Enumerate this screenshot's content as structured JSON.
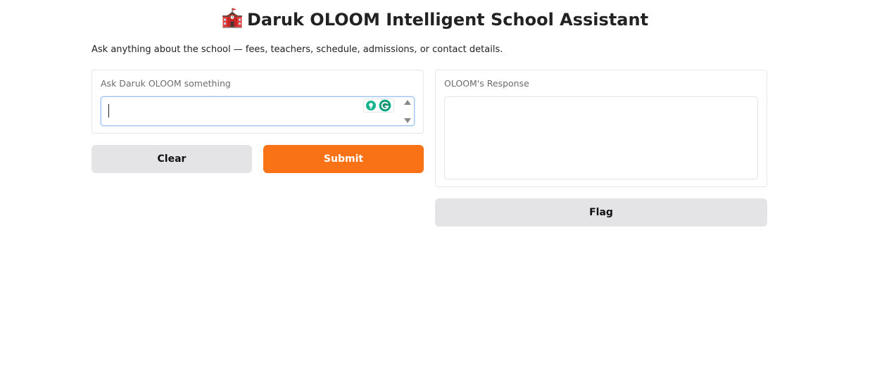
{
  "header": {
    "icon": "school-building-icon",
    "title": "Daruk OLOOM Intelligent School Assistant"
  },
  "description": "Ask anything about the school — fees, teachers, schedule, admissions, or contact details.",
  "input_panel": {
    "label": "Ask Daruk OLOOM something",
    "value": "",
    "placeholder": ""
  },
  "output_panel": {
    "label": "OLOOM's Response",
    "value": ""
  },
  "buttons": {
    "clear": "Clear",
    "submit": "Submit",
    "flag": "Flag"
  },
  "colors": {
    "primary": "#f97316",
    "secondary": "#e4e4e7",
    "focus_border": "#9ec3f5"
  }
}
